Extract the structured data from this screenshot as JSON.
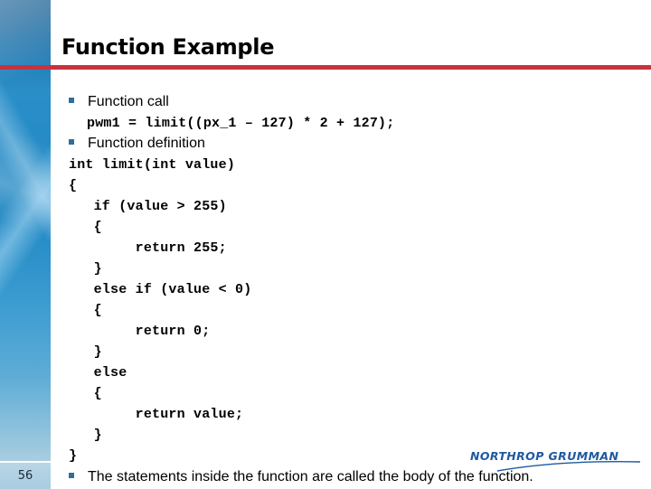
{
  "slide": {
    "title": "Function Example",
    "page_number": "56",
    "accent_color": "#c8323f",
    "bullet_color": "#2d6e9a"
  },
  "bullets": [
    {
      "text": "Function call"
    },
    {
      "text": "Function definition"
    },
    {
      "text": "The statements inside the function are called the body of the function."
    }
  ],
  "code": {
    "call_line": "pwm1 = limit((px_1 – 127) * 2 + 127);",
    "definition_lines": [
      "int limit(int value)",
      "{",
      "   if (value > 255)",
      "   {",
      "        return 255;",
      "   }",
      "   else if (value < 0)",
      "   {",
      "        return 0;",
      "   }",
      "   else",
      "   {",
      "        return value;",
      "   }",
      "}"
    ]
  },
  "logo": {
    "text": "NORTHROP GRUMMAN",
    "color": "#1f5aa0"
  }
}
